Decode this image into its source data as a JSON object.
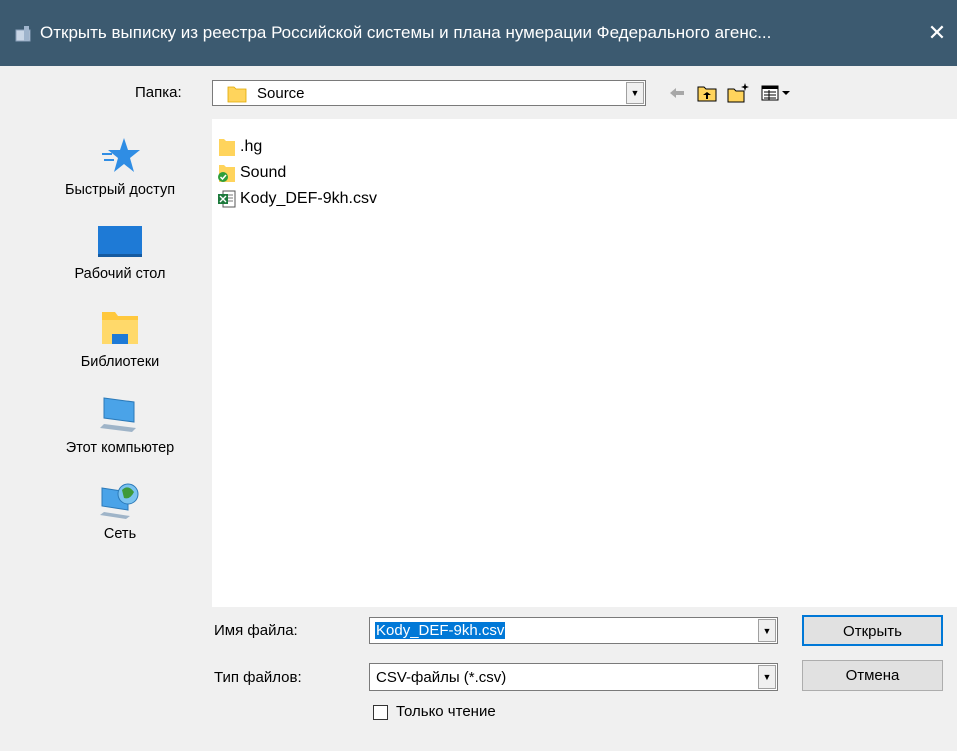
{
  "window": {
    "title": "Открыть выписку из реестра Российской системы и плана нумерации Федерального агенс...",
    "close_glyph": "✕",
    "titlebar_color": "#3c5a70"
  },
  "lookin": {
    "label": "Папка:",
    "value": "Source"
  },
  "toolbar": {
    "back_icon": "back-arrow-icon",
    "up_icon": "up-folder-icon",
    "new_folder_icon": "new-folder-icon",
    "view_icon": "view-menu-icon"
  },
  "places": [
    {
      "label": "Быстрый доступ",
      "icon": "star-icon"
    },
    {
      "label": "Рабочий стол",
      "icon": "desktop-icon"
    },
    {
      "label": "Библиотеки",
      "icon": "libraries-icon"
    },
    {
      "label": "Этот компьютер",
      "icon": "computer-icon"
    },
    {
      "label": "Сеть",
      "icon": "network-icon"
    }
  ],
  "files": [
    {
      "name": ".hg",
      "icon": "folder-icon"
    },
    {
      "name": "Sound",
      "icon": "folder-synced-icon"
    },
    {
      "name": "Kody_DEF-9kh.csv",
      "icon": "csv-file-icon"
    }
  ],
  "filename": {
    "label": "Имя файла:",
    "value": "Kody_DEF-9kh.csv"
  },
  "filetype": {
    "label": "Тип файлов:",
    "value": "CSV-файлы (*.csv)"
  },
  "readonly": {
    "label": "Только чтение",
    "checked": false
  },
  "buttons": {
    "open": "Открыть",
    "cancel": "Отмена"
  },
  "colors": {
    "accent": "#0078d7",
    "folder": "#ffd45c"
  }
}
